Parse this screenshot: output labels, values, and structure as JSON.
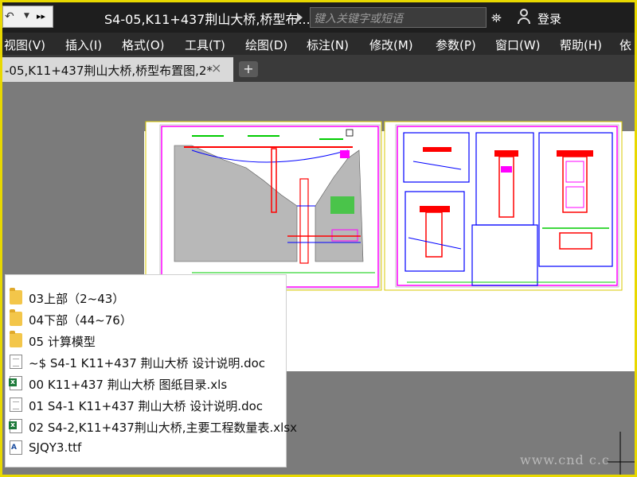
{
  "titlebar": {
    "document_title": "S4-05,K11+437荆山大桥,桥型布...",
    "search_placeholder": "键入关键字或短语",
    "login_label": "登录",
    "icons": [
      "undo-icon",
      "dropdown-icon",
      "more-icon",
      "binoculars-icon",
      "user-icon"
    ]
  },
  "menu": {
    "items": [
      "视图(V)",
      "插入(I)",
      "格式(O)",
      "工具(T)",
      "绘图(D)",
      "标注(N)",
      "修改(M)",
      "参数(P)",
      "窗口(W)",
      "帮助(H)",
      "依"
    ]
  },
  "tabs": {
    "active_label": "-05,K11+437荆山大桥,桥型布置图,2*",
    "close_glyph": "×",
    "add_glyph": "+"
  },
  "file_list": {
    "items": [
      {
        "type": "folder",
        "name": "03上部（2~43）"
      },
      {
        "type": "folder",
        "name": "04下部（44~76）"
      },
      {
        "type": "folder",
        "name": "05 计算模型"
      },
      {
        "type": "doc",
        "name": "~$ S4-1 K11+437 荆山大桥 设计说明.doc"
      },
      {
        "type": "xls",
        "name": "00 K11+437 荆山大桥 图纸目录.xls"
      },
      {
        "type": "doc",
        "name": "01 S4-1 K11+437 荆山大桥 设计说明.doc"
      },
      {
        "type": "xls",
        "name": "02 S4-2,K11+437荆山大桥,主要工程数量表.xlsx"
      },
      {
        "type": "font",
        "name": "SJQY3.ttf"
      }
    ]
  },
  "watermark": "www.cnd c.c",
  "colors": {
    "outer_border": "#e8d800",
    "titlebar_bg": "#1e1e1e",
    "canvas_bg": "#7b7b7b",
    "paper_bg": "#ffffff",
    "drawing_border": "#ff00ff",
    "drawing_blue": "#0000ff",
    "drawing_red": "#ff0000",
    "drawing_green": "#00cc00"
  }
}
